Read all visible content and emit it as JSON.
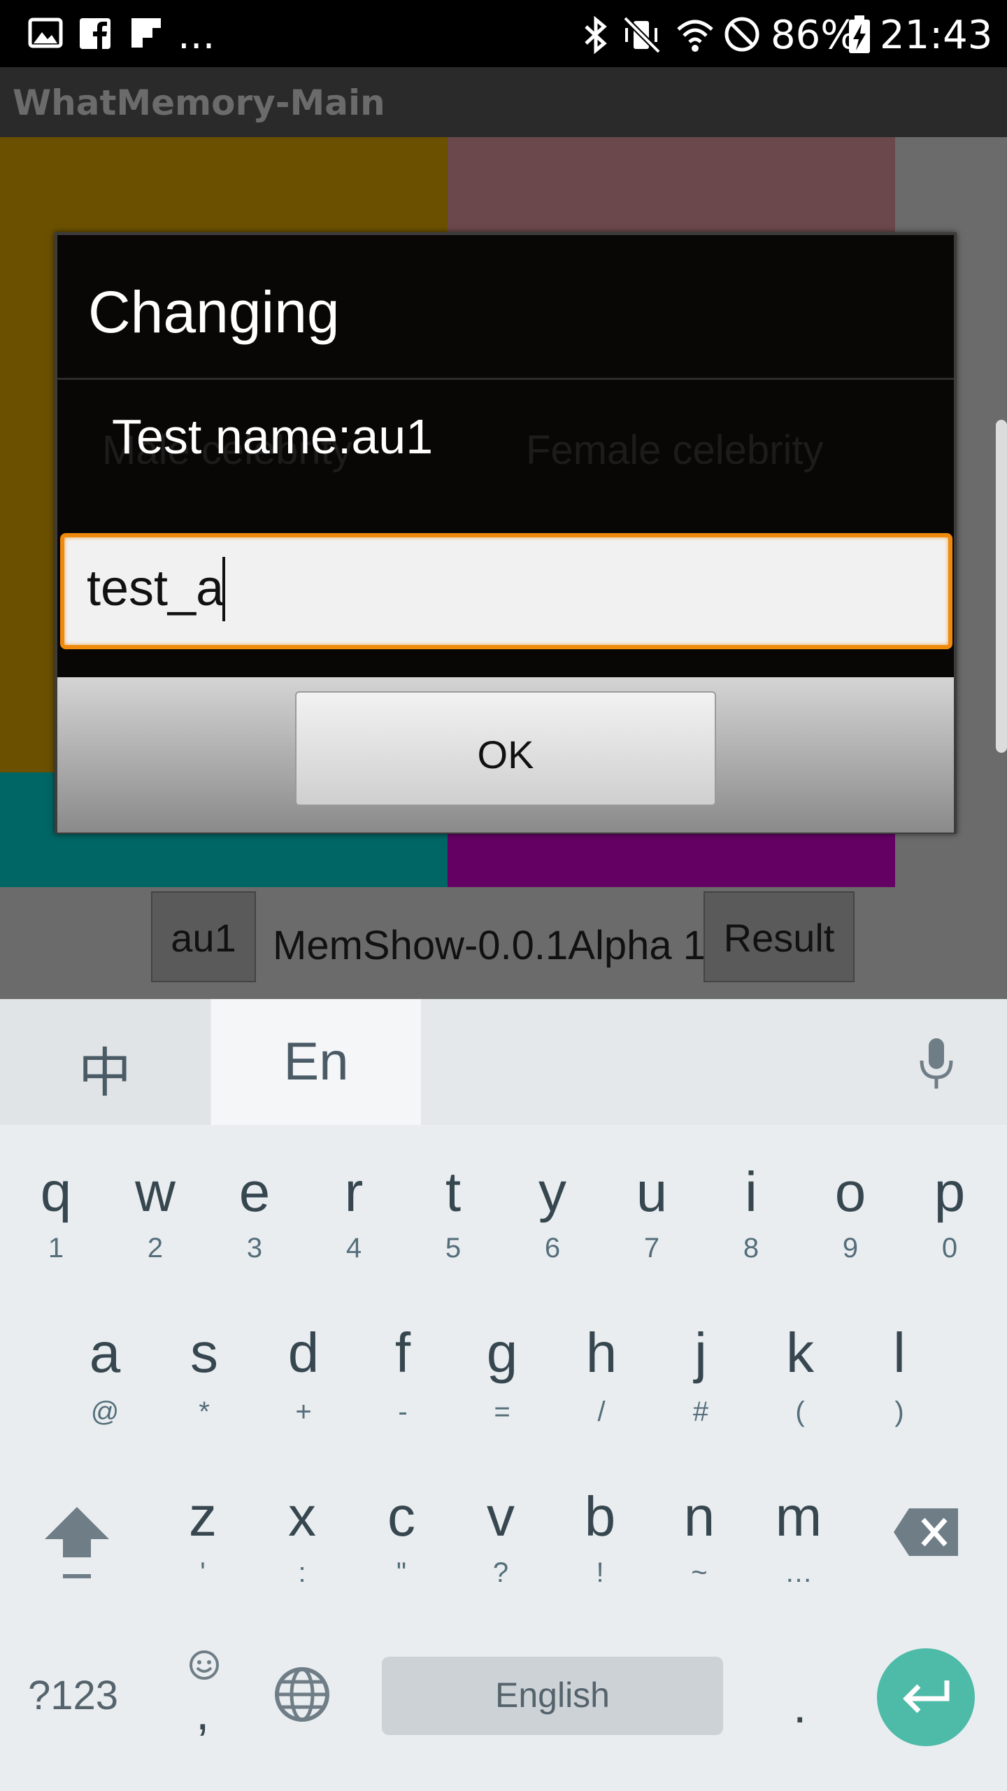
{
  "status_bar": {
    "overflow": "...",
    "battery": "86%",
    "time": "21:43",
    "left_icons": [
      "gallery-icon",
      "facebook-icon",
      "flipboard-icon"
    ],
    "right_icons": [
      "bluetooth-icon",
      "vibrate-mute-icon",
      "wifi-icon",
      "do-not-disturb-icon",
      "battery-charging-icon"
    ]
  },
  "app": {
    "title": "WhatMemory-Main",
    "panel_labels": {
      "left": "Male celebrity",
      "right": "Female celebrity"
    },
    "bottom": {
      "left_button": "au1",
      "center_text": "MemShow-0.0.1Alpha 1",
      "right_button": "Result"
    },
    "colors": {
      "panel_olive": "#6b5000",
      "panel_rose": "#6a484b",
      "panel_teal": "#006565",
      "panel_purple": "#640064"
    }
  },
  "dialog": {
    "title": "Changing",
    "message": "Test name:au1",
    "input_value": "test_a",
    "ok_label": "OK",
    "accent": "#f08a0c"
  },
  "keyboard": {
    "lang_tabs": {
      "zh": "中",
      "en": "En"
    },
    "mic": "microphone-icon",
    "row1": [
      {
        "k": "q",
        "s": "1"
      },
      {
        "k": "w",
        "s": "2"
      },
      {
        "k": "e",
        "s": "3"
      },
      {
        "k": "r",
        "s": "4"
      },
      {
        "k": "t",
        "s": "5"
      },
      {
        "k": "y",
        "s": "6"
      },
      {
        "k": "u",
        "s": "7"
      },
      {
        "k": "i",
        "s": "8"
      },
      {
        "k": "o",
        "s": "9"
      },
      {
        "k": "p",
        "s": "0"
      }
    ],
    "row2": [
      {
        "k": "a",
        "s": "@"
      },
      {
        "k": "s",
        "s": "*"
      },
      {
        "k": "d",
        "s": "+"
      },
      {
        "k": "f",
        "s": "-"
      },
      {
        "k": "g",
        "s": "="
      },
      {
        "k": "h",
        "s": "/"
      },
      {
        "k": "j",
        "s": "#"
      },
      {
        "k": "k",
        "s": "("
      },
      {
        "k": "l",
        "s": ")"
      }
    ],
    "row3": [
      {
        "k": "z",
        "s": "'"
      },
      {
        "k": "x",
        "s": ":"
      },
      {
        "k": "c",
        "s": "\""
      },
      {
        "k": "v",
        "s": "?"
      },
      {
        "k": "b",
        "s": "!"
      },
      {
        "k": "n",
        "s": "~"
      },
      {
        "k": "m",
        "s": "…"
      }
    ],
    "symbols": "?123",
    "comma": ",",
    "space": "English",
    "period": ".",
    "accent": "#4ebaa8"
  }
}
